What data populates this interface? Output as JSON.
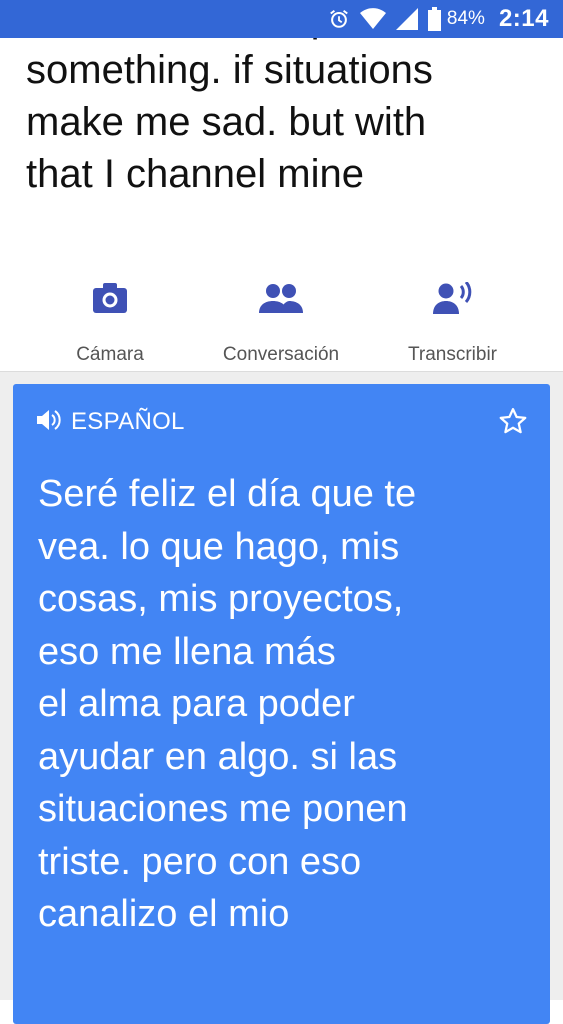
{
  "status_bar": {
    "battery": "84%",
    "time": "2:14",
    "icons": [
      "alarm-icon",
      "wifi-icon",
      "signal-icon",
      "battery-icon"
    ]
  },
  "source": {
    "text": "to be able to help with\nsomething. if situations\nmake me sad. but with\nthat I channel mine"
  },
  "actions": [
    {
      "label": "Cámara",
      "icon": "camera-icon"
    },
    {
      "label": "Conversación",
      "icon": "conversation-icon"
    },
    {
      "label": "Transcribir",
      "icon": "transcribe-icon"
    }
  ],
  "translation": {
    "language": "ESPAÑOL",
    "text": "Seré feliz el día que te\nvea.  lo que hago, mis\ncosas, mis proyectos,\neso me llena más\nel alma para poder\nayudar en algo.  si las\nsituaciones me ponen\ntriste.  pero con eso\ncanalizo el mio"
  },
  "colors": {
    "status_bar": "#3367d6",
    "card": "#4285f4",
    "icon_accent": "#3f51b5"
  }
}
